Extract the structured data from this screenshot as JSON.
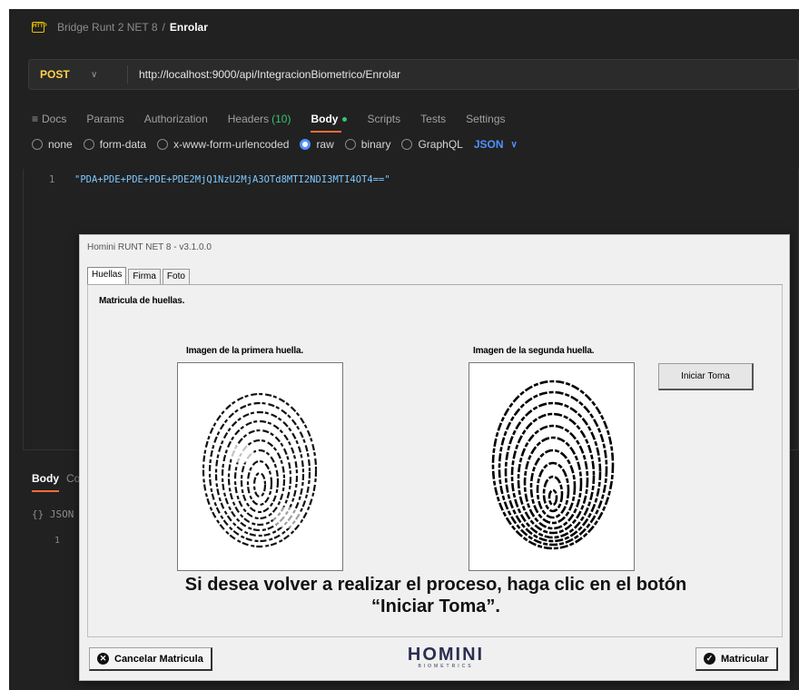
{
  "breadcrumb": {
    "parent": "Bridge Runt 2 NET 8",
    "separator": "/",
    "current": "Enrolar"
  },
  "request": {
    "method": "POST",
    "url": "http://localhost:9000/api/IntegracionBiometrico/Enrolar"
  },
  "tabs": {
    "docs": "Docs",
    "params": "Params",
    "authorization": "Authorization",
    "headers": "Headers",
    "headers_count": "(10)",
    "body": "Body",
    "scripts": "Scripts",
    "tests": "Tests",
    "settings": "Settings"
  },
  "body_types": {
    "none": "none",
    "form_data": "form-data",
    "urlencoded": "x-www-form-urlencoded",
    "raw": "raw",
    "binary": "binary",
    "graphql": "GraphQL",
    "format": "JSON",
    "selected": "raw"
  },
  "editor": {
    "line_number": "1",
    "content": "\"PDA+PDE+PDE+PDE+PDE2MjQ1NzU2MjA3OTd8MTI2NDI3MTI4OT4==\""
  },
  "response": {
    "tab_body": "Body",
    "tab_other": "Co",
    "format": "{} JSON",
    "line_number": "1"
  },
  "dialog": {
    "title": "Homini RUNT NET 8 - v3.1.0.0",
    "tabs": [
      "Huellas",
      "Firma",
      "Foto"
    ],
    "active_tab": "Huellas",
    "heading": "Matricula de huellas.",
    "first_print_label": "Imagen de la primera huella.",
    "second_print_label": "Imagen de la segunda huella.",
    "start_button": "Iniciar Toma",
    "instruction_line1": "Si desea volver a realizar el proceso, haga clic en el botón",
    "instruction_line2": "“Iniciar Toma”.",
    "cancel_button": "Cancelar Matricula",
    "logo_main": "HOMINI",
    "logo_sub": "BIOMETRICS",
    "enroll_button": "Matricular"
  }
}
